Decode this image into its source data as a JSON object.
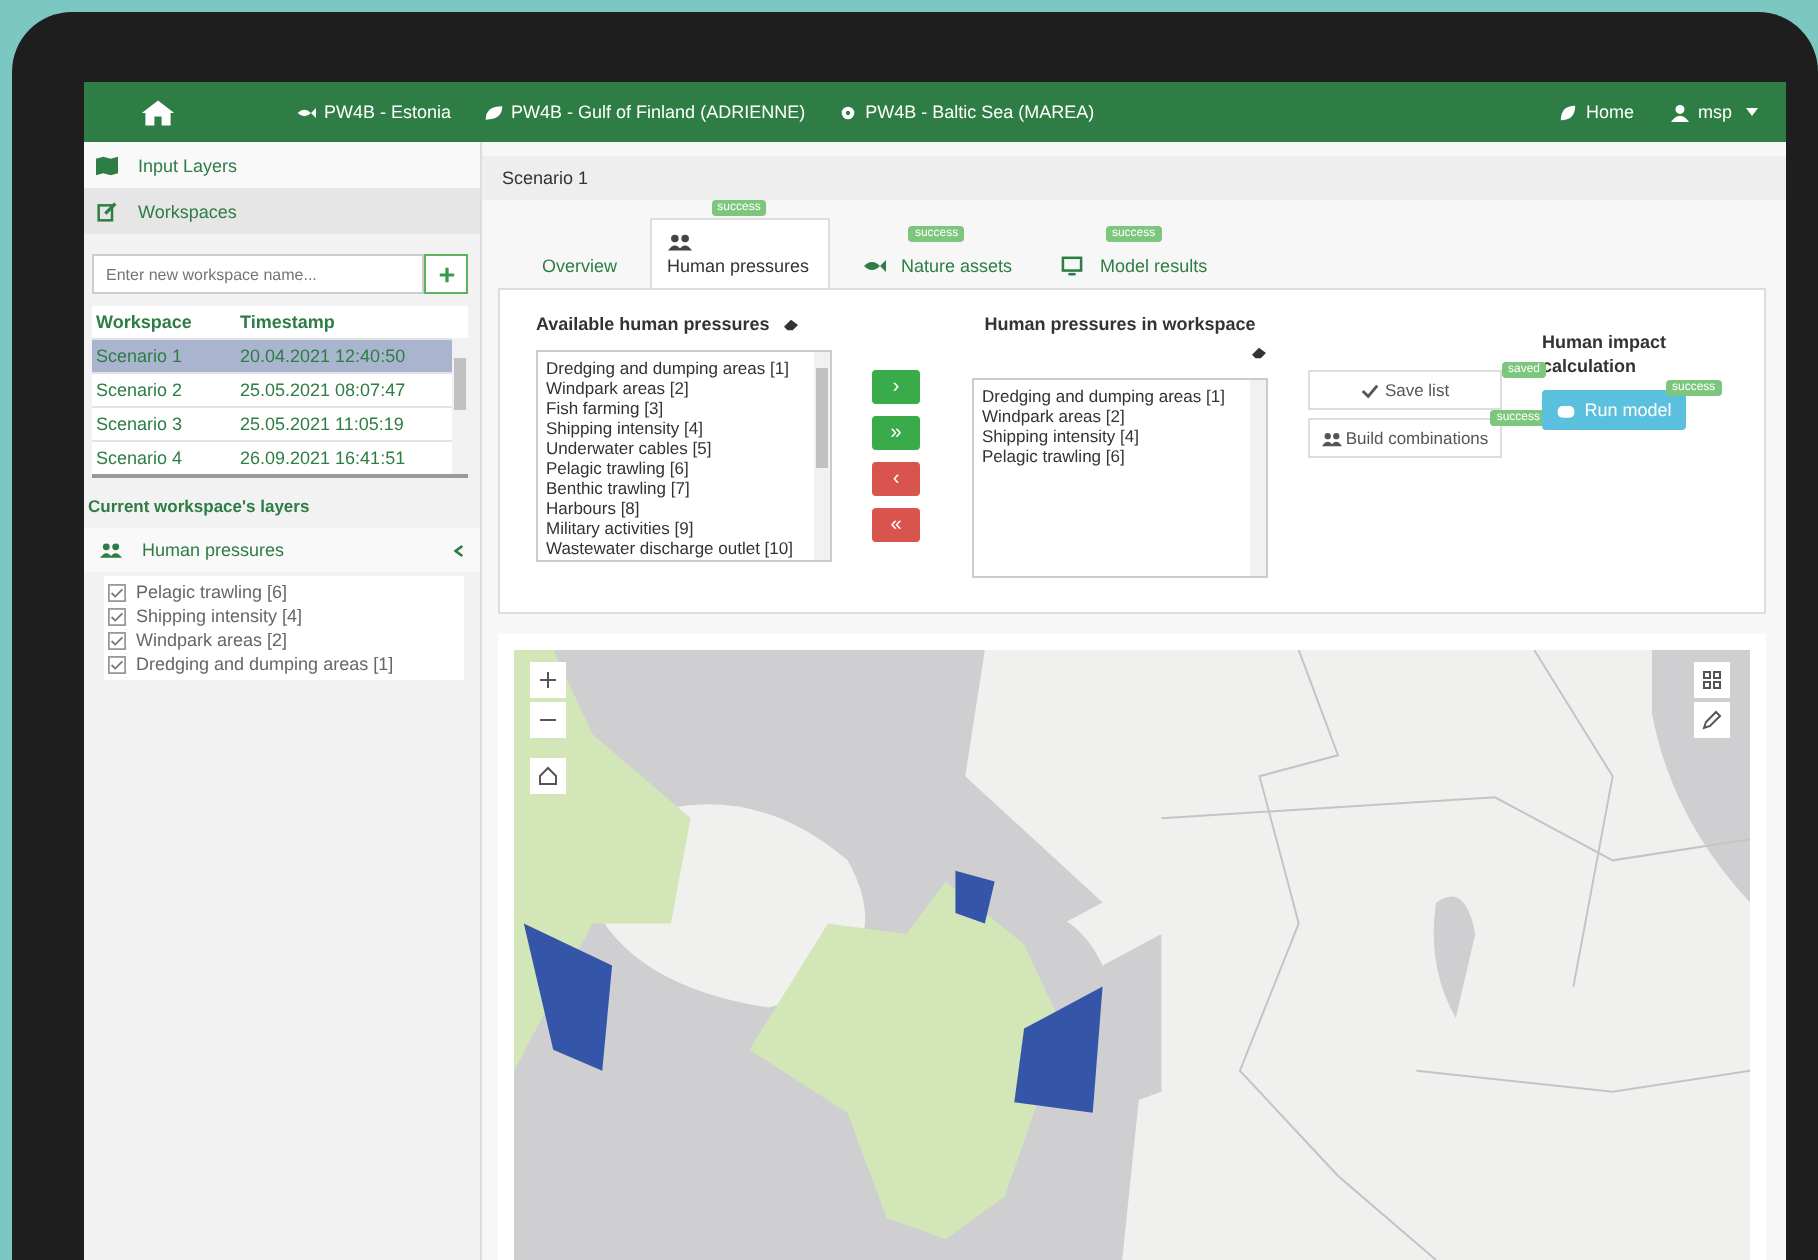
{
  "navbar": {
    "links": [
      {
        "label": "PW4B - Estonia"
      },
      {
        "label": "PW4B - Gulf of Finland (ADRIENNE)"
      },
      {
        "label": "PW4B - Baltic Sea (MAREA)"
      }
    ],
    "home": "Home",
    "user": "msp"
  },
  "sidebar": {
    "sections": [
      {
        "label": "Input Layers",
        "selected": false
      },
      {
        "label": "Workspaces",
        "selected": true
      }
    ],
    "new_workspace": {
      "placeholder": "Enter new workspace name..."
    },
    "table": {
      "columns": [
        "Workspace",
        "Timestamp"
      ],
      "rows": [
        {
          "name": "Scenario 1",
          "timestamp": "20.04.2021 12:40:50",
          "selected": true
        },
        {
          "name": "Scenario 2",
          "timestamp": "25.05.2021 08:07:47",
          "selected": false
        },
        {
          "name": "Scenario 3",
          "timestamp": "25.05.2021 11:05:19",
          "selected": false
        },
        {
          "name": "Scenario 4",
          "timestamp": "26.09.2021 16:41:51",
          "selected": false
        }
      ]
    },
    "layers_heading": "Current workspace's layers",
    "layer_group": {
      "label": "Human pressures",
      "expanded": true
    },
    "layers": [
      {
        "label": "Pelagic trawling [6]",
        "checked": true
      },
      {
        "label": "Shipping intensity [4]",
        "checked": true
      },
      {
        "label": "Windpark areas [2]",
        "checked": true
      },
      {
        "label": "Dredging and dumping areas [1]",
        "checked": true
      }
    ]
  },
  "main": {
    "title": "Scenario 1",
    "tabs": [
      {
        "label": "Overview",
        "selected": false
      },
      {
        "label": "Human pressures",
        "badge": "success",
        "selected": true
      },
      {
        "label": "Nature assets",
        "badge": "success",
        "selected": false
      },
      {
        "label": "Model results",
        "badge": "success",
        "selected": false
      }
    ],
    "available": {
      "title": "Available human pressures",
      "items": [
        "Dredging and dumping areas [1]",
        "Windpark areas [2]",
        "Fish farming [3]",
        "Shipping intensity [4]",
        "Underwater cables [5]",
        "Pelagic trawling [6]",
        "Benthic trawling [7]",
        "Harbours [8]",
        "Military activities [9]",
        "Wastewater discharge outlet [10]"
      ]
    },
    "move_buttons": [
      {
        "label": "›",
        "kind": "add"
      },
      {
        "label": "»",
        "kind": "add"
      },
      {
        "label": "‹",
        "kind": "remove"
      },
      {
        "label": "«",
        "kind": "remove"
      }
    ],
    "workspace": {
      "title": "Human pressures in workspace",
      "items": [
        "Dredging and dumping areas [1]",
        "Windpark areas [2]",
        "Shipping intensity [4]",
        "Pelagic trawling [6]"
      ]
    },
    "actions": [
      {
        "label": "Save list",
        "badge": "saved"
      },
      {
        "label": "Build combinations",
        "badge": "success"
      }
    ],
    "impact": {
      "title": "Human impact calculation",
      "button": "Run model",
      "badge": "success"
    }
  }
}
